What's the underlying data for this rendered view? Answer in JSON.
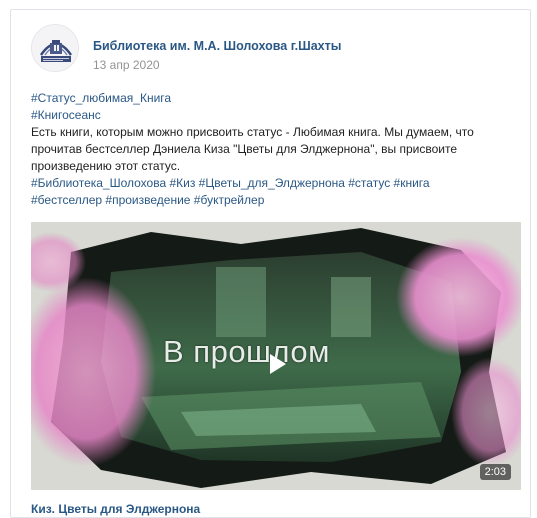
{
  "post": {
    "author": "Библиотека им. М.А. Шолохова г.Шахты",
    "date": "13 апр 2020",
    "hashtag_line1": "#Статус_любимая_Книга",
    "hashtag_line2": "#Книгосеанс",
    "text_line1": "Есть книги, которым можно присвоить статус - Любимая книга. Мы думаем, что",
    "text_line2": "прочитав бестселлер Дэниела Киза \"Цветы для Элджернона\", вы присвоите",
    "text_line3": "произведению этот статус.",
    "hashtags_line3": "#Библиотека_Шолохова #Киз #Цветы_для_Элджернона #статус #книга",
    "hashtags_line4": "#бестселлер #произведение #буктрейлер"
  },
  "video": {
    "overlay_text": "В прошлом",
    "duration": "2:03",
    "title": "Киз. Цветы для Элджернона",
    "play_icon": "play-icon"
  },
  "colors": {
    "link": "#2a5885",
    "secondary_text": "#939393",
    "border": "#dfe3e8"
  }
}
